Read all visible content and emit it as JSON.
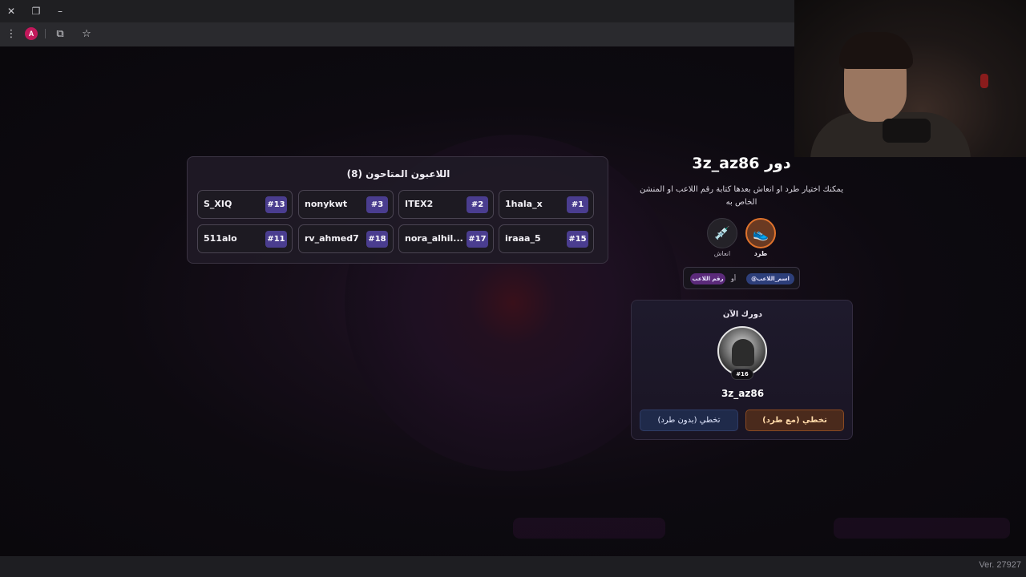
{
  "browser": {
    "close_glyph": "✕",
    "restore_glyph": "❐",
    "minimize_glyph": "–",
    "menu_glyph": "⋮",
    "profile_initial": "A",
    "extensions_glyph": "⧉",
    "bookmark_glyph": "☆"
  },
  "players_panel": {
    "title": "اللاعبون المتاحون (8)",
    "players": [
      {
        "name": "1hala_x",
        "number": "#1"
      },
      {
        "name": "ITEX2",
        "number": "#2"
      },
      {
        "name": "nonykwt",
        "number": "#3"
      },
      {
        "name": "S_XIQ",
        "number": "#13"
      },
      {
        "name": "iraaa_5",
        "number": "#15"
      },
      {
        "name": "nora_alhil...",
        "number": "#17"
      },
      {
        "name": "rv_ahmed7",
        "number": "#18"
      },
      {
        "name": "511alo",
        "number": "#11"
      }
    ]
  },
  "turn": {
    "title": "دور 3z_az86",
    "description": "يمكنك اختيار طرد او انعاش بعدها كتابة رقم اللاعب او المنشن الخاص به",
    "actions": {
      "kick_label": "طرد",
      "kick_icon": "sneaker-icon",
      "kick_glyph": "👟",
      "revive_label": "انعاش",
      "revive_icon": "syringe-icon",
      "revive_glyph": "💉"
    },
    "hint": {
      "name_chip": "@اسم_اللاعب",
      "or": "أو",
      "number_chip": "رقم اللاعب"
    }
  },
  "current": {
    "title": "دورك الآن",
    "player_number": "#16",
    "player_name": "3z_az86",
    "skip_with_kick": "تخطي (مع طرد)",
    "skip_without_kick": "تخطي (بدون طرد)"
  },
  "footer": {
    "version": "Ver. 27927"
  },
  "colors": {
    "accent_number_badge": "#4a3d8f",
    "kick_ring": "#e0732c",
    "background": "#0b090d"
  }
}
